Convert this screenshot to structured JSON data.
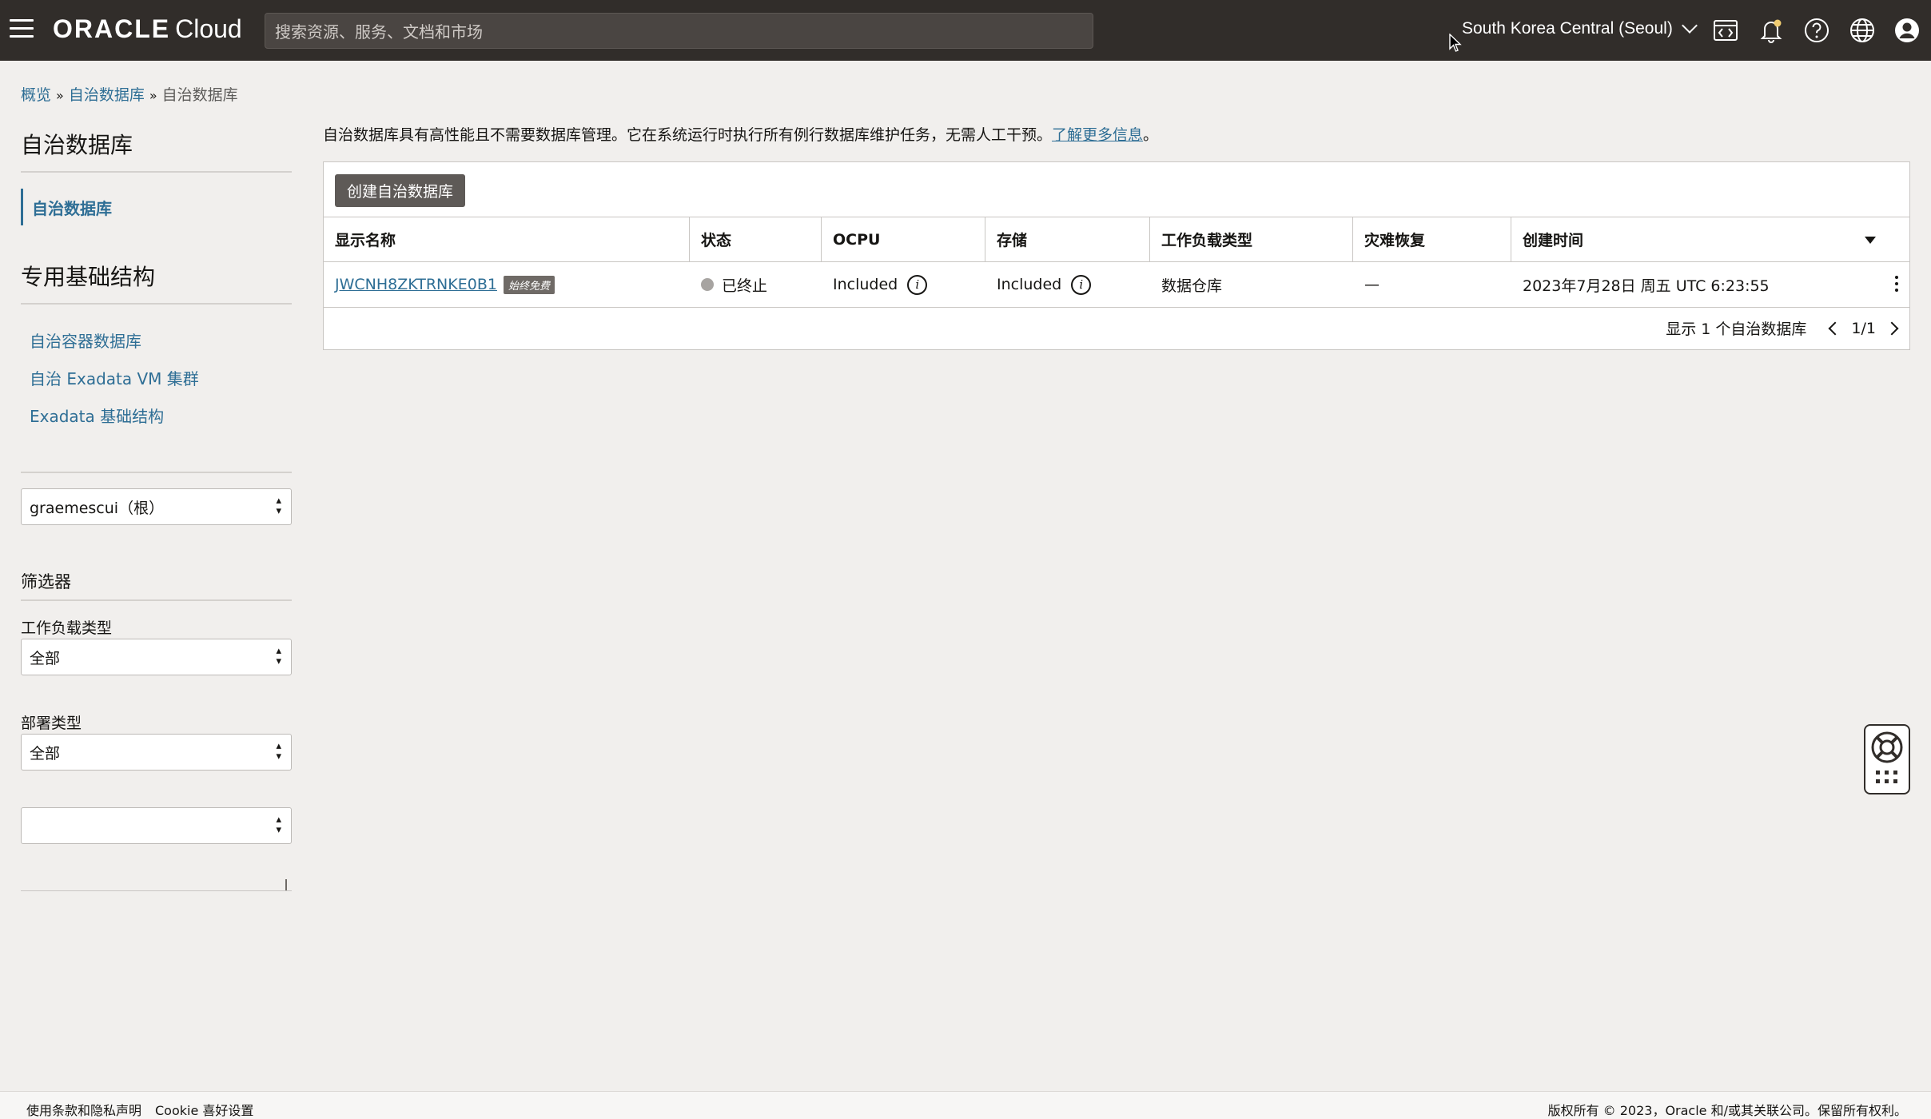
{
  "header": {
    "brand_oracle": "ORACLE",
    "brand_cloud": "Cloud",
    "search_placeholder": "搜索资源、服务、文档和市场",
    "region": "South Korea Central (Seoul)"
  },
  "breadcrumb": {
    "items": [
      "概览",
      "自治数据库",
      "自治数据库"
    ],
    "separator": "»"
  },
  "sidebar": {
    "title": "自治数据库",
    "active_item": "自治数据库",
    "section_title": "专用基础结构",
    "links": [
      "自治容器数据库",
      "自治 Exadata VM 集群",
      "Exadata 基础结构"
    ],
    "compartment": "graemescui（根）",
    "filters_title": "筛选器",
    "workload_label": "工作负载类型",
    "workload_value": "全部",
    "deployment_label": "部署类型",
    "deployment_value": "全部",
    "extra_value": ""
  },
  "main": {
    "intro_text": "自治数据库具有高性能且不需要数据库管理。它在系统运行时执行所有例行数据库维护任务，无需人工干预。",
    "intro_link": "了解更多信息",
    "intro_end": "。",
    "create_button": "创建自治数据库",
    "columns": [
      "显示名称",
      "状态",
      "OCPU",
      "存储",
      "工作负载类型",
      "灾难恢复",
      "创建时间"
    ],
    "rows": [
      {
        "name": "JWCNH8ZKTRNKE0B1",
        "badge": "始终免费",
        "status": "已终止",
        "ocpu": "Included",
        "storage": "Included",
        "workload": "数据仓库",
        "dr": "—",
        "created": "2023年7月28日 周五 UTC 6:23:55"
      }
    ],
    "pager_text": "显示 1 个自治数据库",
    "pager_pages": "1/1"
  },
  "footer": {
    "terms": "使用条款和隐私声明",
    "cookie": "Cookie 喜好设置",
    "copyright": "版权所有 © 2023，Oracle 和/或其关联公司。保留所有权利。"
  },
  "colors": {
    "header_bg": "#312d2a",
    "link": "#2e6e95",
    "page_bg": "#f1efed",
    "button_bg": "#5e5a57"
  }
}
